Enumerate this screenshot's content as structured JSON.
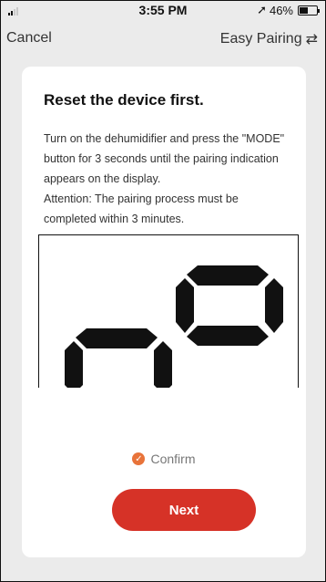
{
  "status_bar": {
    "time": "3:55 PM",
    "battery_percent": "46%",
    "location_icon": "location-arrow-icon"
  },
  "nav": {
    "cancel_label": "Cancel",
    "mode_label": "Easy Pairing",
    "mode_icon": "swap-arrows-icon"
  },
  "card": {
    "title": "Reset the device first.",
    "description_lines": [
      "Turn on the dehumidifier and press the \"MODE\"",
      "button for 3 seconds until the pairing indication",
      "appears on the display.",
      "Attention: The pairing process must be",
      "completed within 3 minutes."
    ],
    "confirm_label": "Confirm",
    "next_label": "Next"
  },
  "colors": {
    "accent": "#d63227",
    "confirm_check": "#e8733a",
    "background": "#ebebeb"
  }
}
